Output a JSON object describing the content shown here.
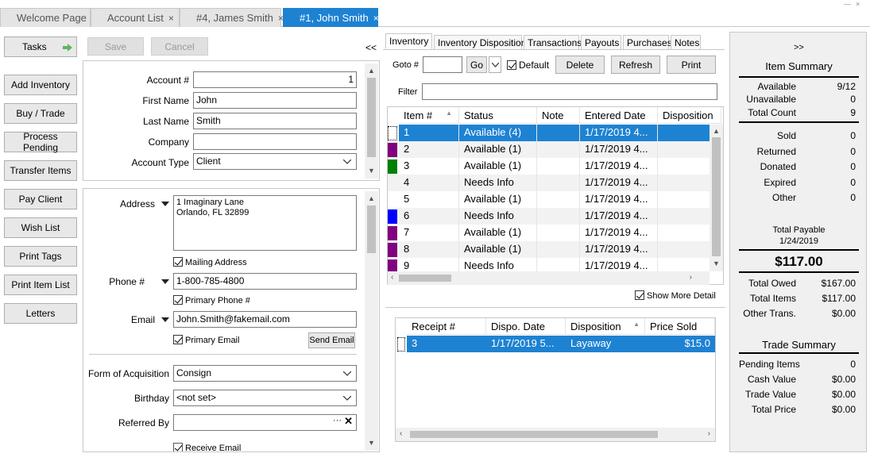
{
  "doc_tabs": [
    {
      "label": "Welcome Page"
    },
    {
      "label": "Account List"
    },
    {
      "label": "#4, James Smith"
    },
    {
      "label": "#1, John Smith"
    }
  ],
  "close_glyph": "×",
  "window_controls": {
    "minimize": "—",
    "close": "×"
  },
  "sidebar": {
    "tasks": "Tasks",
    "items": [
      "Add Inventory",
      "Buy / Trade",
      "Process Pending",
      "Transfer Items",
      "Pay Client",
      "Wish List",
      "Print Tags",
      "Print Item List",
      "Letters"
    ]
  },
  "toolbar": {
    "save": "Save",
    "cancel": "Cancel",
    "collapse": "<<"
  },
  "account": {
    "account_no_label": "Account #",
    "account_no": "1",
    "first_name_label": "First Name",
    "first_name": "John",
    "last_name_label": "Last Name",
    "last_name": "Smith",
    "company_label": "Company",
    "company": "",
    "account_type_label": "Account Type",
    "account_type": "Client"
  },
  "contact": {
    "address_label": "Address",
    "address_line1": "1 Imaginary Lane",
    "address_line2": "Orlando, FL  32899",
    "mailing_address": "Mailing Address",
    "phone_label": "Phone #",
    "phone": "1-800-785-4800",
    "primary_phone": "Primary Phone #",
    "email_label": "Email",
    "email": "John.Smith@fakemail.com",
    "primary_email": "Primary Email",
    "send_email": "Send Email",
    "acq_label": "Form of Acquisition",
    "acq": "Consign",
    "birthday_label": "Birthday",
    "birthday": "<not set>",
    "referred_label": "Referred By",
    "referred": "",
    "receive_email": "Receive Email"
  },
  "inv_tabs": [
    "Inventory",
    "Inventory Disposition",
    "Transactions",
    "Payouts",
    "Purchases",
    "Notes"
  ],
  "inv_toolbar": {
    "goto_label": "Goto #",
    "go": "Go",
    "default": "Default",
    "delete": "Delete",
    "refresh": "Refresh",
    "print": "Print",
    "filter_label": "Filter"
  },
  "inv_grid": {
    "columns": [
      "Item #",
      "Status",
      "Note",
      "Entered Date",
      "Disposition"
    ],
    "rows": [
      {
        "item": "1",
        "status": "Available (4)",
        "note": "",
        "date": "1/17/2019 4...",
        "disp": "",
        "color": "",
        "selected": true
      },
      {
        "item": "2",
        "status": "Available (1)",
        "note": "",
        "date": "1/17/2019 4...",
        "disp": "",
        "color": "#800080",
        "selected": false
      },
      {
        "item": "3",
        "status": "Available (1)",
        "note": "",
        "date": "1/17/2019 4...",
        "disp": "",
        "color": "#008000",
        "selected": false
      },
      {
        "item": "4",
        "status": "Needs Info",
        "note": "",
        "date": "1/17/2019 4...",
        "disp": "",
        "color": "",
        "selected": false
      },
      {
        "item": "5",
        "status": "Available (1)",
        "note": "",
        "date": "1/17/2019 4...",
        "disp": "",
        "color": "",
        "selected": false
      },
      {
        "item": "6",
        "status": "Needs Info",
        "note": "",
        "date": "1/17/2019 4...",
        "disp": "",
        "color": "#0000ff",
        "selected": false
      },
      {
        "item": "7",
        "status": "Available (1)",
        "note": "",
        "date": "1/17/2019 4...",
        "disp": "",
        "color": "#800080",
        "selected": false
      },
      {
        "item": "8",
        "status": "Available (1)",
        "note": "",
        "date": "1/17/2019 4...",
        "disp": "",
        "color": "#800080",
        "selected": false
      },
      {
        "item": "9",
        "status": "Needs Info",
        "note": "",
        "date": "1/17/2019 4...",
        "disp": "",
        "color": "#800080",
        "selected": false
      }
    ]
  },
  "show_more_detail": "Show More Detail",
  "disp_grid": {
    "columns": [
      "Receipt #",
      "Dispo. Date",
      "Disposition",
      "Price Sold"
    ],
    "rows": [
      {
        "receipt": "3",
        "date": "1/17/2019 5...",
        "disp": "Layaway",
        "price": "$15.0"
      }
    ]
  },
  "summary": {
    "expand": ">>",
    "item_summary": "Item Summary",
    "stats1": [
      {
        "label": "Available",
        "value": "9/12"
      },
      {
        "label": "Unavailable",
        "value": "0"
      },
      {
        "label": "Total Count",
        "value": "9"
      }
    ],
    "stats2": [
      {
        "label": "Sold",
        "value": "0"
      },
      {
        "label": "Returned",
        "value": "0"
      },
      {
        "label": "Donated",
        "value": "0"
      },
      {
        "label": "Expired",
        "value": "0"
      },
      {
        "label": "Other",
        "value": "0"
      }
    ],
    "total_payable_label": "Total Payable",
    "total_payable_date": "1/24/2019",
    "total_payable": "$117.00",
    "stats3": [
      {
        "label": "Total Owed",
        "value": "$167.00"
      },
      {
        "label": "Total Items",
        "value": "$117.00"
      },
      {
        "label": "Other Trans.",
        "value": "$0.00"
      }
    ],
    "trade_summary": "Trade Summary",
    "stats4": [
      {
        "label": "Pending Items",
        "value": "0"
      },
      {
        "label": "Cash Value",
        "value": "$0.00"
      },
      {
        "label": "Trade Value",
        "value": "$0.00"
      },
      {
        "label": "Total Price",
        "value": "$0.00"
      }
    ]
  },
  "colors": {
    "accent": "#1e82d2",
    "selected_row": "#1e82d2",
    "task_arrow": "#5cb85c"
  }
}
